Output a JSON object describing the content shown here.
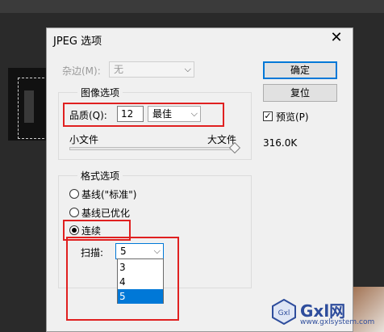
{
  "dialog": {
    "title": "JPEG 选项",
    "close_glyph": "✕"
  },
  "matte": {
    "label": "杂边(M):",
    "value": "无",
    "chevron": "⌵"
  },
  "image_options": {
    "legend": "图像选项",
    "quality_label": "品质(Q):",
    "quality_value": "12",
    "quality_preset": "最佳",
    "chevron": "⌵",
    "small_file": "小文件",
    "large_file": "大文件",
    "slider_level": 1.0
  },
  "format_options": {
    "legend": "格式选项",
    "radios": [
      {
        "label": "基线(\"标准\")",
        "checked": false
      },
      {
        "label": "基线已优化",
        "checked": false
      },
      {
        "label": "连续",
        "checked": true
      }
    ],
    "scans_label": "扫描:",
    "scans_value": "5",
    "scans_chevron": "⌵",
    "scans_options": [
      "3",
      "4",
      "5"
    ],
    "scans_selected": "5"
  },
  "buttons": {
    "ok": "确定",
    "reset": "复位"
  },
  "preview": {
    "label": "预览(P)",
    "checked": true,
    "check_glyph": "✓"
  },
  "file_size": "316.0K",
  "watermark": {
    "text": "Gxl网",
    "domain": "www.gxlsystem.com",
    "logo_text": "Gxl"
  },
  "colors": {
    "highlight": "#e02020",
    "selection": "#0078d7",
    "dialog_bg": "#f0f0f0"
  }
}
